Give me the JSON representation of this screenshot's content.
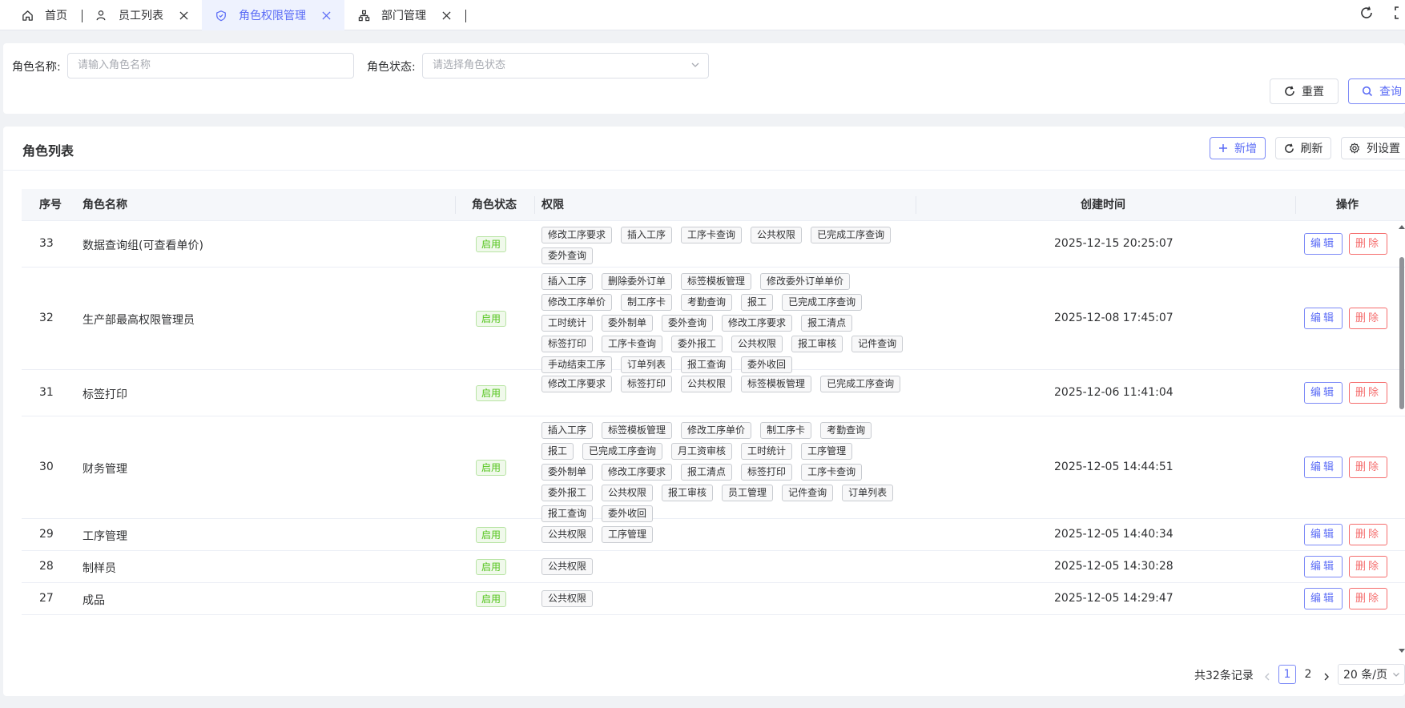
{
  "tabs": [
    {
      "label": "首页",
      "icon": "home-icon"
    },
    {
      "label": "员工列表",
      "icon": "user-icon"
    },
    {
      "label": "角色权限管理",
      "icon": "shield-icon"
    },
    {
      "label": "部门管理",
      "icon": "org-chart-icon"
    }
  ],
  "search": {
    "role_name_label": "角色名称:",
    "role_name_placeholder": "请输入角色名称",
    "role_status_label": "角色状态:",
    "role_status_placeholder": "请选择角色状态",
    "reset_label": "重置",
    "query_label": "查询"
  },
  "card": {
    "title": "角色列表",
    "add_label": "新增",
    "refresh_label": "刷新",
    "columns_label": "列设置"
  },
  "table": {
    "headers": {
      "index": "序号",
      "name": "角色名称",
      "status": "角色状态",
      "perms": "权限",
      "created": "创建时间",
      "actions": "操作"
    },
    "edit_label": "编辑",
    "delete_label": "删除",
    "rows": [
      {
        "id": "33",
        "name": "数据查询组(可查看单价)",
        "status": "启用",
        "created": "2025-12-15 20:25:07",
        "perms": [
          "修改工序要求",
          "插入工序",
          "工序卡查询",
          "公共权限",
          "已完成工序查询",
          "委外查询"
        ]
      },
      {
        "id": "32",
        "name": "生产部最高权限管理员",
        "status": "启用",
        "created": "2025-12-08 17:45:07",
        "perms": [
          "插入工序",
          "删除委外订单",
          "标签模板管理",
          "修改委外订单单价",
          "修改工序单价",
          "制工序卡",
          "考勤查询",
          "报工",
          "已完成工序查询",
          "工时统计",
          "委外制单",
          "委外查询",
          "修改工序要求",
          "报工清点",
          "标签打印",
          "工序卡查询",
          "委外报工",
          "公共权限",
          "报工审核",
          "记件查询",
          "手动结束工序",
          "订单列表",
          "报工查询",
          "委外收回"
        ]
      },
      {
        "id": "31",
        "name": "标签打印",
        "status": "启用",
        "created": "2025-12-06 11:41:04",
        "perms": [
          "修改工序要求",
          "标签打印",
          "公共权限",
          "标签模板管理",
          "已完成工序查询"
        ]
      },
      {
        "id": "30",
        "name": "财务管理",
        "status": "启用",
        "created": "2025-12-05 14:44:51",
        "perms": [
          "插入工序",
          "标签模板管理",
          "修改工序单价",
          "制工序卡",
          "考勤查询",
          "报工",
          "已完成工序查询",
          "月工资审核",
          "工时统计",
          "工序管理",
          "委外制单",
          "修改工序要求",
          "报工清点",
          "标签打印",
          "工序卡查询",
          "委外报工",
          "公共权限",
          "报工审核",
          "员工管理",
          "记件查询",
          "订单列表",
          "报工查询",
          "委外收回"
        ]
      },
      {
        "id": "29",
        "name": "工序管理",
        "status": "启用",
        "created": "2025-12-05 14:40:34",
        "perms": [
          "公共权限",
          "工序管理"
        ]
      },
      {
        "id": "28",
        "name": "制样员",
        "status": "启用",
        "created": "2025-12-05 14:30:28",
        "perms": [
          "公共权限"
        ]
      },
      {
        "id": "27",
        "name": "成品",
        "status": "启用",
        "created": "2025-12-05 14:29:47",
        "perms": [
          "公共权限"
        ]
      }
    ]
  },
  "pagination": {
    "total": "共32条记录",
    "pages": [
      "1",
      "2"
    ],
    "current_page": "1",
    "page_size": "20 条/页"
  },
  "colors": {
    "accent": "#5b6cf6",
    "success": "#52c41a",
    "danger": "#f56c6c"
  }
}
